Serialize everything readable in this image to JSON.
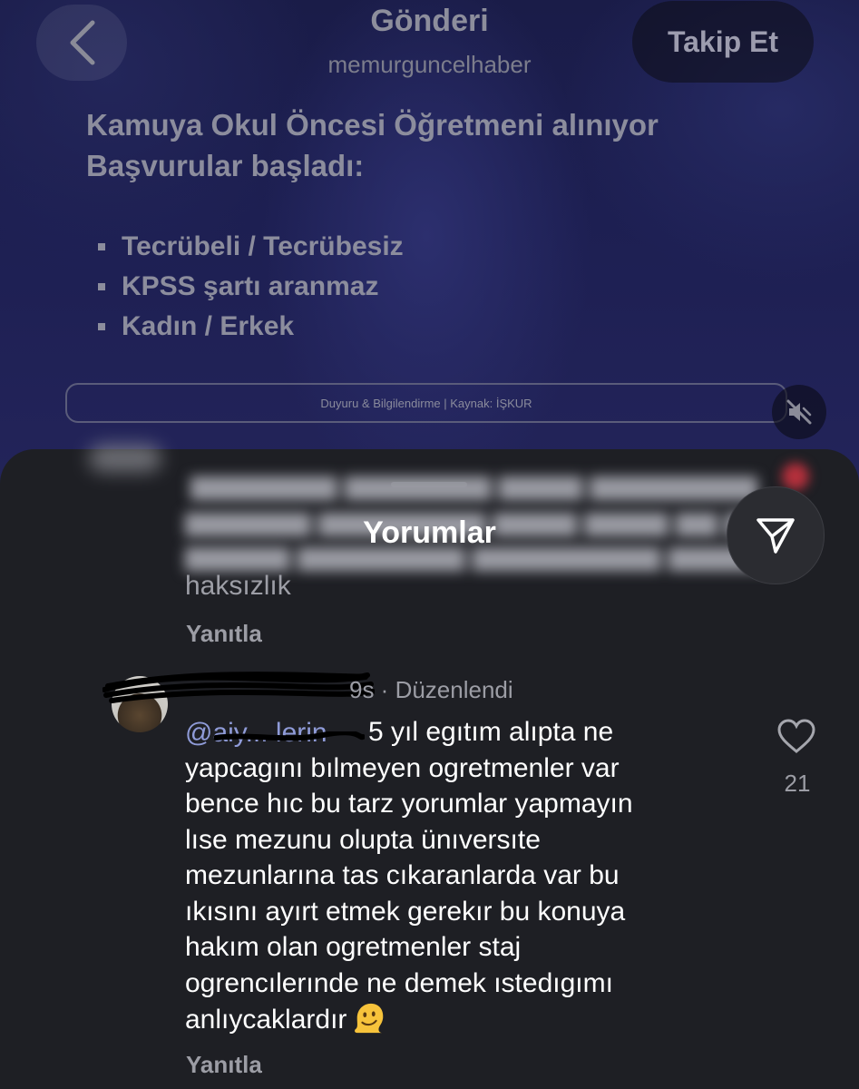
{
  "post": {
    "title": "Gönderi",
    "username": "memurguncelhaber",
    "follow_label": "Takip Et",
    "headline_line1": "Kamuya Okul Öncesi Öğretmeni alınıyor",
    "headline_line2": "Başvurular başladı:",
    "bullets": [
      "Tecrübeli / Tecrübesiz",
      "KPSS şartı aranmaz",
      "Kadın / Erkek"
    ],
    "source_caption": "Duyuru & Bilgilendirme | Kaynak: İŞKUR"
  },
  "comments_sheet": {
    "title": "Yorumlar",
    "first_comment": {
      "visible_tail": "haksızlık",
      "reply_label": "Yanıtla"
    },
    "second_comment": {
      "meta_suffix": "9s · Düzenlendi",
      "mention_fragment": "@aiy... lerin",
      "lines": [
        "5 yıl egıtım alıpta ne",
        "yapcagını bılmeyen ogretmenler var",
        "bence hıc bu tarz yorumlar yapmayın",
        "lıse mezunu olupta ünıversıte",
        "mezunlarına tas cıkaranlarda var bu",
        "ıkısını ayırt etmek gerekır  bu konuya",
        "hakım olan ogretmenler staj",
        "ogrencılerınde ne demek ıstedıgımı",
        "anlıycaklardır"
      ],
      "emoji": "melting-face",
      "like_count": "21",
      "reply_label": "Yanıtla"
    }
  },
  "colors": {
    "sheet_bg": "#1e1f24",
    "mention": "#8f9bd8",
    "post_overlay": "#1d1f52"
  }
}
